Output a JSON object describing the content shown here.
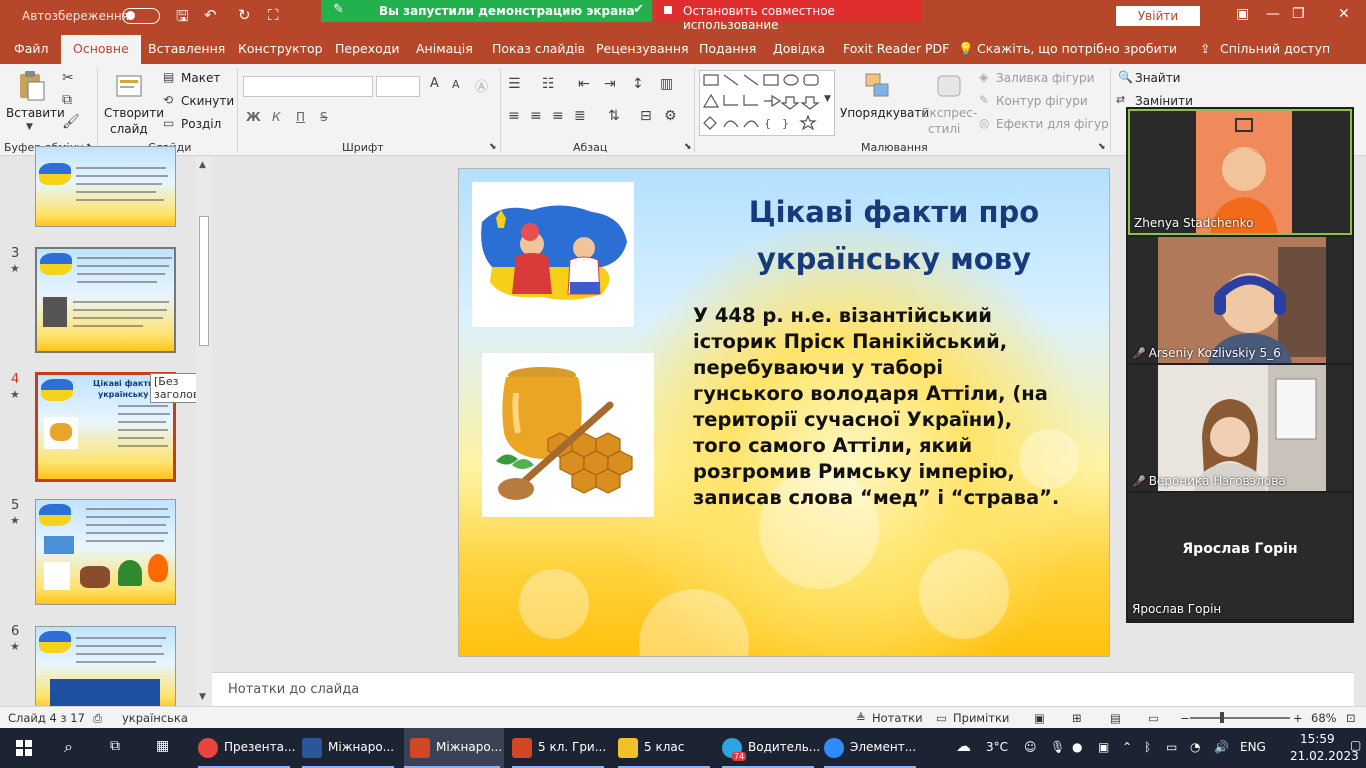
{
  "titlebar": {
    "autosave": "Автозбереження",
    "share_banner": "Вы запустили демонстрацию экрана",
    "stop_banner": "Остановить совместное использование",
    "signin": "Увійти"
  },
  "menu": {
    "tabs": [
      "Файл",
      "Основне",
      "Вставлення",
      "Конструктор",
      "Переходи",
      "Анімація",
      "Показ слайдів",
      "Рецензування",
      "Подання",
      "Довідка",
      "Foxit Reader PDF"
    ],
    "active_tab": "Основне",
    "tell_me": "Скажіть, що потрібно зробити",
    "share": "Спільний доступ"
  },
  "ribbon": {
    "clipboard": {
      "paste": "Вставити",
      "group": "Буфер обміну"
    },
    "slides": {
      "new_slide": "Створити",
      "new_slide_2": "слайд",
      "layout": "Макет",
      "reset": "Скинути",
      "section": "Розділ",
      "group": "Слайди"
    },
    "font": {
      "bold": "Ж",
      "italic": "К",
      "underline": "П",
      "strike": "S",
      "group": "Шрифт"
    },
    "paragraph": {
      "group": "Абзац"
    },
    "drawing": {
      "arrange": "Упорядкувати",
      "quick_styles_1": "Експрес-",
      "quick_styles_2": "стилі",
      "fill": "Заливка фігури",
      "outline": "Контур фігури",
      "effects": "Ефекти для фігур",
      "group": "Малювання"
    },
    "editing": {
      "find": "Знайти",
      "replace": "Замінити"
    }
  },
  "thumbnails": [
    {
      "num": "3",
      "star": "★"
    },
    {
      "num": "4",
      "star": "★"
    },
    {
      "num": "5",
      "star": "★"
    },
    {
      "num": "6",
      "star": "★"
    }
  ],
  "thumb4": {
    "title_1": "Цікаві факти п",
    "title_2": "українську мову"
  },
  "tooltip": "[Без заголовка]",
  "slide": {
    "title": "Цікаві факти про українську мову",
    "body": "У 448 р. н.е. візантійський\nісторик Пріск Панікійський,\nперебуваючи у таборі\nгунського володаря Аттіли, (на\nтериторії сучасної України),\nтого самого Аттіли, який\nрозгромив Римську імперію,\nзаписав слова “мед” і “страва”."
  },
  "notes": "Нотатки до слайда",
  "zoom": {
    "participants": [
      {
        "name": "Zhenya Stadchenko",
        "muted": false
      },
      {
        "name": "Arseniy Kozlivskiy 5_6",
        "muted": true
      },
      {
        "name": "Вероника Нэговэлова",
        "muted": true
      },
      {
        "name": "Ярослав Горін",
        "muted": false
      }
    ],
    "center_name": "Ярослав Горін"
  },
  "status": {
    "slide_info": "Слайд 4 з 17",
    "language": "українська",
    "notes_btn": "Нотатки",
    "comments_btn": "Примітки",
    "zoom_level": "68%"
  },
  "taskbar": {
    "apps": [
      {
        "label": "Презента...",
        "color": "#e8453c"
      },
      {
        "label": "Міжнаро...",
        "color": "#2b579a"
      },
      {
        "label": "Міжнаро...",
        "color": "#d24726"
      },
      {
        "label": "5 кл. Гри...",
        "color": "#d24726"
      },
      {
        "label": "5 клас",
        "color": "#f2c029"
      },
      {
        "label": "Водитель...",
        "color": "#2ca5e0"
      },
      {
        "label": "Элемент...",
        "color": "#2d8cff"
      }
    ],
    "telegram_badge": "74",
    "weather": "3°C",
    "lang": "ENG",
    "time": "15:59",
    "date": "21.02.2023"
  },
  "colors": {
    "accent": "#b7472a",
    "slide_title": "#173a7a",
    "green_banner": "#23b14d",
    "red_banner": "#e02e2e"
  }
}
